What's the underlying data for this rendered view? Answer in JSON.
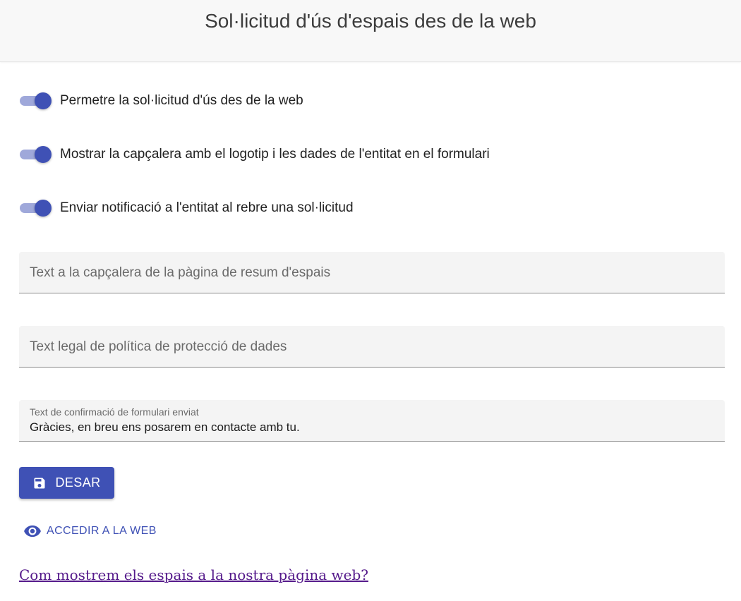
{
  "header": {
    "title": "Sol·licitud d'ús d'espais des de la web"
  },
  "toggles": [
    {
      "label": "Permetre la sol·licitud d'ús des de la web",
      "checked": true
    },
    {
      "label": "Mostrar la capçalera amb el logotip i les dades de l'entitat en el formulari",
      "checked": true
    },
    {
      "label": "Enviar notificació a l'entitat al rebre una sol·licitud",
      "checked": true
    }
  ],
  "fields": {
    "header_text": {
      "placeholder": "Text a la capçalera de la pàgina de resum d'espais",
      "value": ""
    },
    "legal_text": {
      "placeholder": "Text legal de política de protecció de dades",
      "value": ""
    },
    "confirmation_text": {
      "label": "Text de confirmació de formulari enviat",
      "value": "Gràcies, en breu ens posarem en contacte amb tu."
    }
  },
  "actions": {
    "save_label": "DESAR",
    "save_icon": "save-icon",
    "web_label": "ACCEDIR A LA WEB",
    "web_icon": "eye-icon",
    "help_link": "Com mostrem els espais a la nostra pàgina web?"
  },
  "colors": {
    "primary": "#3f51b5",
    "switch_track": "#9fa8da",
    "visited_link": "#551a8b"
  }
}
